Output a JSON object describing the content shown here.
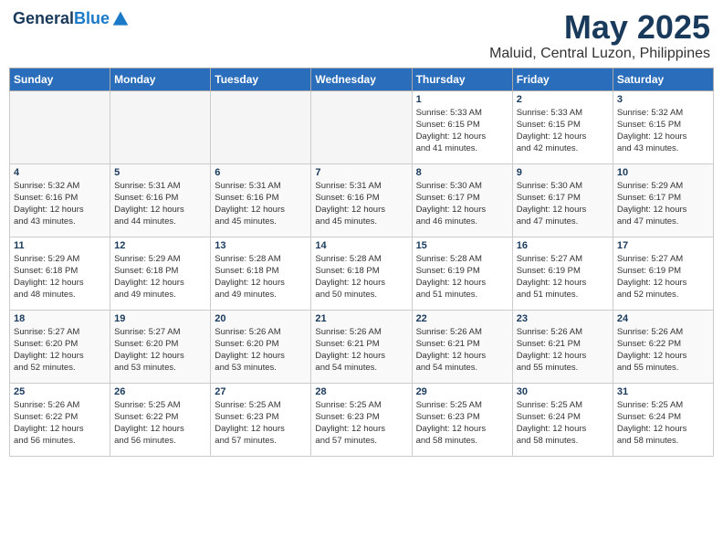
{
  "header": {
    "logo_general": "General",
    "logo_blue": "Blue",
    "month_title": "May 2025",
    "location": "Maluid, Central Luzon, Philippines"
  },
  "calendar": {
    "days_of_week": [
      "Sunday",
      "Monday",
      "Tuesday",
      "Wednesday",
      "Thursday",
      "Friday",
      "Saturday"
    ],
    "weeks": [
      [
        {
          "day": "",
          "info": ""
        },
        {
          "day": "",
          "info": ""
        },
        {
          "day": "",
          "info": ""
        },
        {
          "day": "",
          "info": ""
        },
        {
          "day": "1",
          "info": "Sunrise: 5:33 AM\nSunset: 6:15 PM\nDaylight: 12 hours\nand 41 minutes."
        },
        {
          "day": "2",
          "info": "Sunrise: 5:33 AM\nSunset: 6:15 PM\nDaylight: 12 hours\nand 42 minutes."
        },
        {
          "day": "3",
          "info": "Sunrise: 5:32 AM\nSunset: 6:15 PM\nDaylight: 12 hours\nand 43 minutes."
        }
      ],
      [
        {
          "day": "4",
          "info": "Sunrise: 5:32 AM\nSunset: 6:16 PM\nDaylight: 12 hours\nand 43 minutes."
        },
        {
          "day": "5",
          "info": "Sunrise: 5:31 AM\nSunset: 6:16 PM\nDaylight: 12 hours\nand 44 minutes."
        },
        {
          "day": "6",
          "info": "Sunrise: 5:31 AM\nSunset: 6:16 PM\nDaylight: 12 hours\nand 45 minutes."
        },
        {
          "day": "7",
          "info": "Sunrise: 5:31 AM\nSunset: 6:16 PM\nDaylight: 12 hours\nand 45 minutes."
        },
        {
          "day": "8",
          "info": "Sunrise: 5:30 AM\nSunset: 6:17 PM\nDaylight: 12 hours\nand 46 minutes."
        },
        {
          "day": "9",
          "info": "Sunrise: 5:30 AM\nSunset: 6:17 PM\nDaylight: 12 hours\nand 47 minutes."
        },
        {
          "day": "10",
          "info": "Sunrise: 5:29 AM\nSunset: 6:17 PM\nDaylight: 12 hours\nand 47 minutes."
        }
      ],
      [
        {
          "day": "11",
          "info": "Sunrise: 5:29 AM\nSunset: 6:18 PM\nDaylight: 12 hours\nand 48 minutes."
        },
        {
          "day": "12",
          "info": "Sunrise: 5:29 AM\nSunset: 6:18 PM\nDaylight: 12 hours\nand 49 minutes."
        },
        {
          "day": "13",
          "info": "Sunrise: 5:28 AM\nSunset: 6:18 PM\nDaylight: 12 hours\nand 49 minutes."
        },
        {
          "day": "14",
          "info": "Sunrise: 5:28 AM\nSunset: 6:18 PM\nDaylight: 12 hours\nand 50 minutes."
        },
        {
          "day": "15",
          "info": "Sunrise: 5:28 AM\nSunset: 6:19 PM\nDaylight: 12 hours\nand 51 minutes."
        },
        {
          "day": "16",
          "info": "Sunrise: 5:27 AM\nSunset: 6:19 PM\nDaylight: 12 hours\nand 51 minutes."
        },
        {
          "day": "17",
          "info": "Sunrise: 5:27 AM\nSunset: 6:19 PM\nDaylight: 12 hours\nand 52 minutes."
        }
      ],
      [
        {
          "day": "18",
          "info": "Sunrise: 5:27 AM\nSunset: 6:20 PM\nDaylight: 12 hours\nand 52 minutes."
        },
        {
          "day": "19",
          "info": "Sunrise: 5:27 AM\nSunset: 6:20 PM\nDaylight: 12 hours\nand 53 minutes."
        },
        {
          "day": "20",
          "info": "Sunrise: 5:26 AM\nSunset: 6:20 PM\nDaylight: 12 hours\nand 53 minutes."
        },
        {
          "day": "21",
          "info": "Sunrise: 5:26 AM\nSunset: 6:21 PM\nDaylight: 12 hours\nand 54 minutes."
        },
        {
          "day": "22",
          "info": "Sunrise: 5:26 AM\nSunset: 6:21 PM\nDaylight: 12 hours\nand 54 minutes."
        },
        {
          "day": "23",
          "info": "Sunrise: 5:26 AM\nSunset: 6:21 PM\nDaylight: 12 hours\nand 55 minutes."
        },
        {
          "day": "24",
          "info": "Sunrise: 5:26 AM\nSunset: 6:22 PM\nDaylight: 12 hours\nand 55 minutes."
        }
      ],
      [
        {
          "day": "25",
          "info": "Sunrise: 5:26 AM\nSunset: 6:22 PM\nDaylight: 12 hours\nand 56 minutes."
        },
        {
          "day": "26",
          "info": "Sunrise: 5:25 AM\nSunset: 6:22 PM\nDaylight: 12 hours\nand 56 minutes."
        },
        {
          "day": "27",
          "info": "Sunrise: 5:25 AM\nSunset: 6:23 PM\nDaylight: 12 hours\nand 57 minutes."
        },
        {
          "day": "28",
          "info": "Sunrise: 5:25 AM\nSunset: 6:23 PM\nDaylight: 12 hours\nand 57 minutes."
        },
        {
          "day": "29",
          "info": "Sunrise: 5:25 AM\nSunset: 6:23 PM\nDaylight: 12 hours\nand 58 minutes."
        },
        {
          "day": "30",
          "info": "Sunrise: 5:25 AM\nSunset: 6:24 PM\nDaylight: 12 hours\nand 58 minutes."
        },
        {
          "day": "31",
          "info": "Sunrise: 5:25 AM\nSunset: 6:24 PM\nDaylight: 12 hours\nand 58 minutes."
        }
      ]
    ]
  }
}
